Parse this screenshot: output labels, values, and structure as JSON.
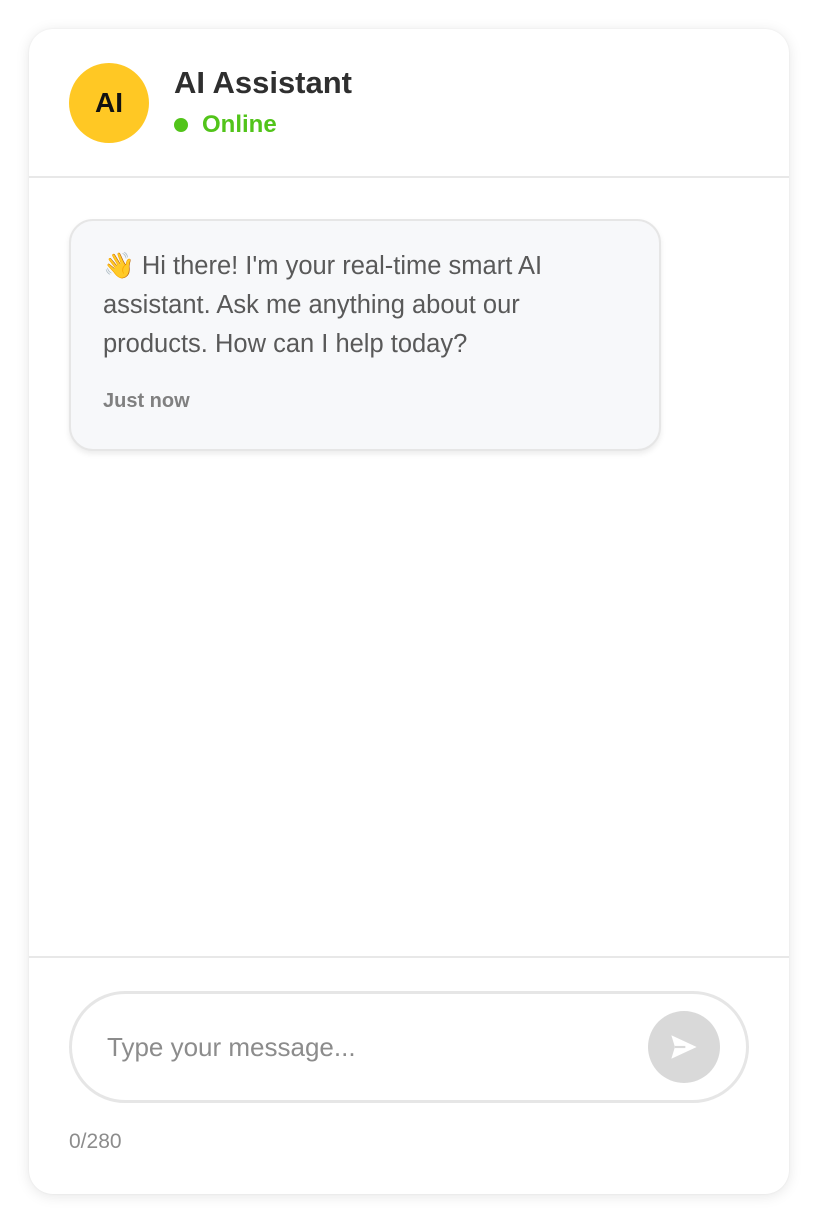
{
  "header": {
    "avatar_initials": "AI",
    "title": "AI Assistant",
    "status": "Online"
  },
  "messages": [
    {
      "sender": "assistant",
      "text": "👋 Hi there! I'm your real-time smart AI assistant. Ask me anything about our products. How can I help today?",
      "time": "Just now"
    }
  ],
  "composer": {
    "input_value": "",
    "placeholder": "Type your message...",
    "send_icon": "send-icon",
    "char_count": "0/280"
  },
  "colors": {
    "avatar_bg": "#ffc824",
    "status_online": "#52c41a",
    "bubble_bg": "#f7f8fa",
    "send_button_disabled": "#d9d9d9"
  }
}
